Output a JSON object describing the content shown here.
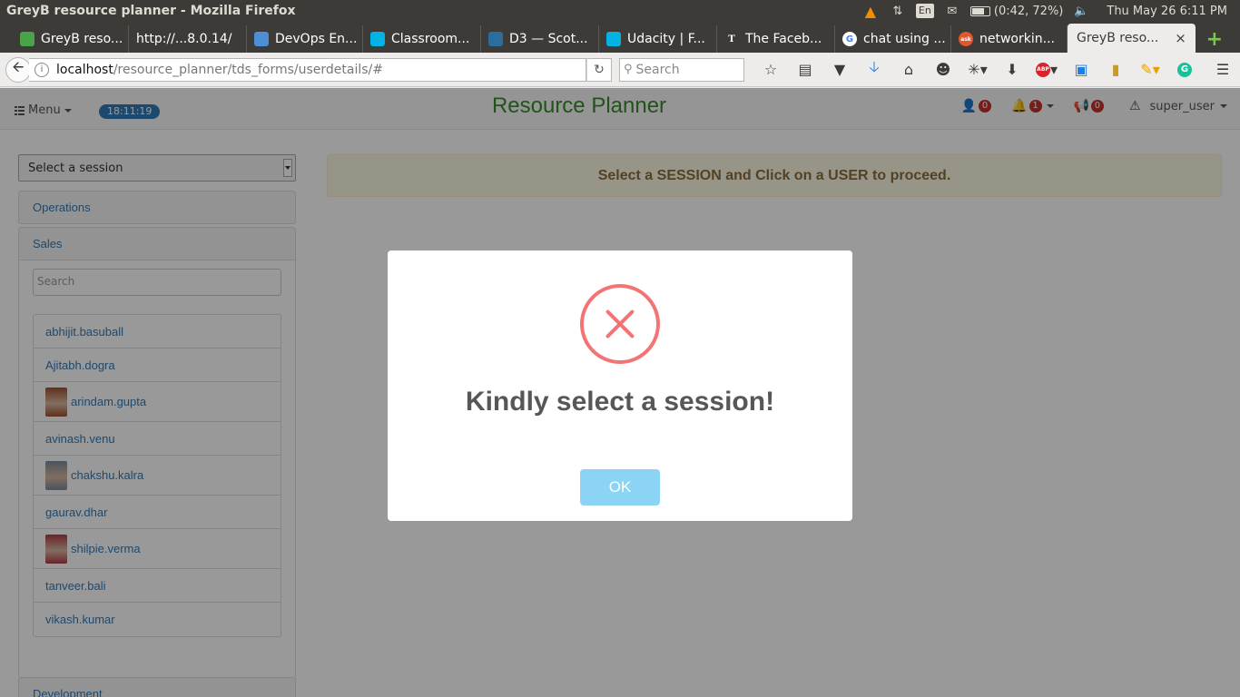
{
  "os": {
    "window_title": "GreyB resource planner - Mozilla Firefox",
    "lang": "En",
    "battery": "(0:42, 72%)",
    "battery_level": 0.72,
    "datetime": "Thu May 26  6:11 PM"
  },
  "tabs": [
    {
      "label": "GreyB reso...",
      "icon": "greyb-favicon",
      "color": "#4aa34a"
    },
    {
      "label": "http://...8.0.14/",
      "icon": "none"
    },
    {
      "label": "DevOps En...",
      "icon": "doc-favicon",
      "color": "#4d8fd6"
    },
    {
      "label": "Classroom...",
      "icon": "udacity-favicon",
      "color": "#02b3e4"
    },
    {
      "label": "D3 — Scot...",
      "icon": "d3-favicon",
      "color": "#2b6d9c"
    },
    {
      "label": "Udacity | F...",
      "icon": "udacity-favicon",
      "color": "#02b3e4"
    },
    {
      "label": "The Faceb...",
      "icon": "nyt-favicon",
      "color": "#222222"
    },
    {
      "label": "chat using ...",
      "icon": "google-favicon",
      "color": "#ffffff"
    },
    {
      "label": "networkin...",
      "icon": "ask-favicon",
      "color": "#e4572e"
    }
  ],
  "active_tab": {
    "label": "GreyB reso...",
    "close": "×"
  },
  "new_tab": "+",
  "nav": {
    "url_host": "localhost",
    "url_path": "/resource_planner/tds_forms/userdetails/#",
    "search_placeholder": "Search"
  },
  "header": {
    "menu_label": "Menu",
    "clock": "18:11:19",
    "brand": "Resource Planner",
    "users_count": "0",
    "notifications_count": "1",
    "announcements_count": "0",
    "username": "super_user"
  },
  "sidebar": {
    "session_select": "Select a session",
    "groups": {
      "operations": "Operations",
      "sales": "Sales",
      "development": "Development"
    },
    "search_placeholder": "Search",
    "users": [
      {
        "name": "abhijit.basuball",
        "avatar": false
      },
      {
        "name": "Ajitabh.dogra",
        "avatar": false
      },
      {
        "name": "arindam.gupta",
        "avatar": true
      },
      {
        "name": "avinash.venu",
        "avatar": false
      },
      {
        "name": "chakshu.kalra",
        "avatar": true
      },
      {
        "name": "gaurav.dhar",
        "avatar": false
      },
      {
        "name": "shilpie.verma",
        "avatar": true
      },
      {
        "name": "tanveer.bali",
        "avatar": false
      },
      {
        "name": "vikash.kumar",
        "avatar": false
      }
    ]
  },
  "alert": "Select a SESSION and Click on a USER to proceed.",
  "modal": {
    "icon": "error-x-icon",
    "title": "Kindly select a session!",
    "ok": "OK",
    "accent": "#f27474",
    "button_color": "#8cd4f5"
  }
}
